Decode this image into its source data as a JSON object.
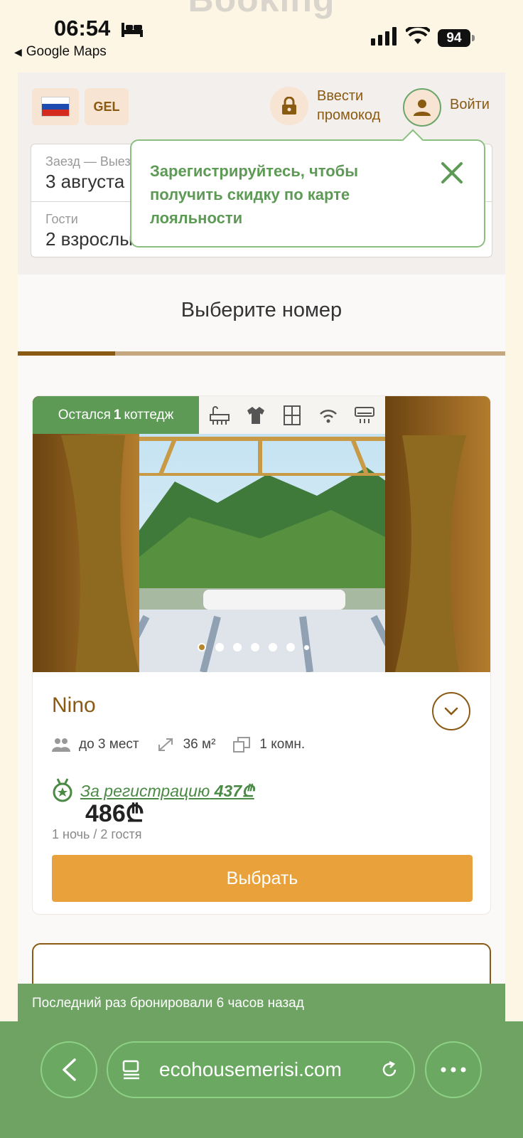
{
  "status_bar": {
    "time": "06:54",
    "back_app": "Google Maps",
    "battery": "94",
    "ghost_title": "Booking"
  },
  "header": {
    "currency": "GEL",
    "promo_label_line1": "Ввести",
    "promo_label_line2": "промокод",
    "login_label": "Войти"
  },
  "search": {
    "dates_label": "Заезд — Выезд",
    "dates_value": "3 августа",
    "guests_label": "Гости",
    "guests_value": "2 взрослых"
  },
  "tooltip": {
    "text": "Зарегистрируйтесь, чтобы получить скидку по карте лояльности"
  },
  "section": {
    "title": "Выберите номер",
    "progress": 0.2
  },
  "room": {
    "badge_prefix": "Остался",
    "badge_count": "1",
    "badge_suffix": "коттедж",
    "amenities": [
      "bathtub-icon",
      "shirt-icon",
      "window-icon",
      "wifi-icon",
      "air-conditioner-icon"
    ],
    "name": "Nino",
    "capacity": "до 3 мест",
    "area": "36 м²",
    "rooms": "1 комн.",
    "registration_label": "За регистрацию",
    "registration_price": "437₾",
    "price": "486₾",
    "price_note": "1 ночь / 2 гостя",
    "select_label": "Выбрать",
    "photo_count": 7,
    "photo_active": 0
  },
  "notice": {
    "text": "Последний раз бронировали 6 часов назад"
  },
  "browser": {
    "url": "ecohousemerisi.com"
  },
  "colors": {
    "brown": "#8a5a12",
    "green": "#5d9a55",
    "orange": "#e9a23b",
    "browser_green": "#6ea364"
  }
}
